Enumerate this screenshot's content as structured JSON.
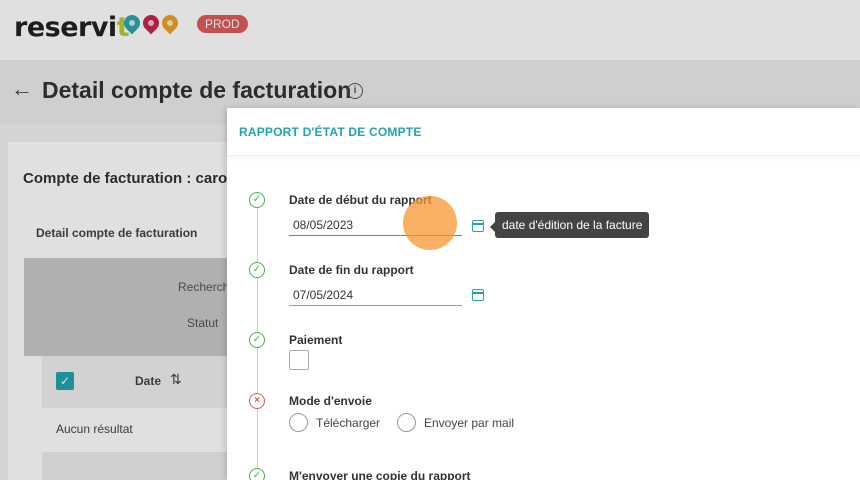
{
  "brand": {
    "name_main": "reservi",
    "name_accent": "t",
    "env_badge": "PROD"
  },
  "page": {
    "title": "Detail compte de facturation"
  },
  "card": {
    "title": "Compte de facturation : caro",
    "tab": "Detail compte de facturation",
    "filter_label_search": "Recherch",
    "filter_label_status": "Statut",
    "table_header_date": "Date",
    "empty_text": "Aucun résultat"
  },
  "panel": {
    "title": "RAPPORT D'ÉTAT DE COMPTE",
    "start_date": {
      "label": "Date de début du rapport",
      "value": "08/05/2023"
    },
    "end_date": {
      "label": "Date de fin du rapport",
      "value": "07/05/2024"
    },
    "tooltip": "date d'édition de la facture",
    "payment": {
      "label": "Paiement"
    },
    "send_mode": {
      "label": "Mode d'envoie",
      "options": [
        "Télécharger",
        "Envoyer par mail"
      ]
    },
    "copy": {
      "label": "M'envoyer une copie du rapport"
    }
  },
  "icons": {
    "back": "arrow-left-icon",
    "info": "info-icon",
    "calendar": "calendar-icon",
    "step_ok": "check-circle-icon",
    "step_error": "x-circle-icon",
    "sort": "sort-icon"
  },
  "colors": {
    "accent": "#23a4ad",
    "success": "#4caf50",
    "error": "#e05555",
    "badge": "#e05a5a"
  }
}
